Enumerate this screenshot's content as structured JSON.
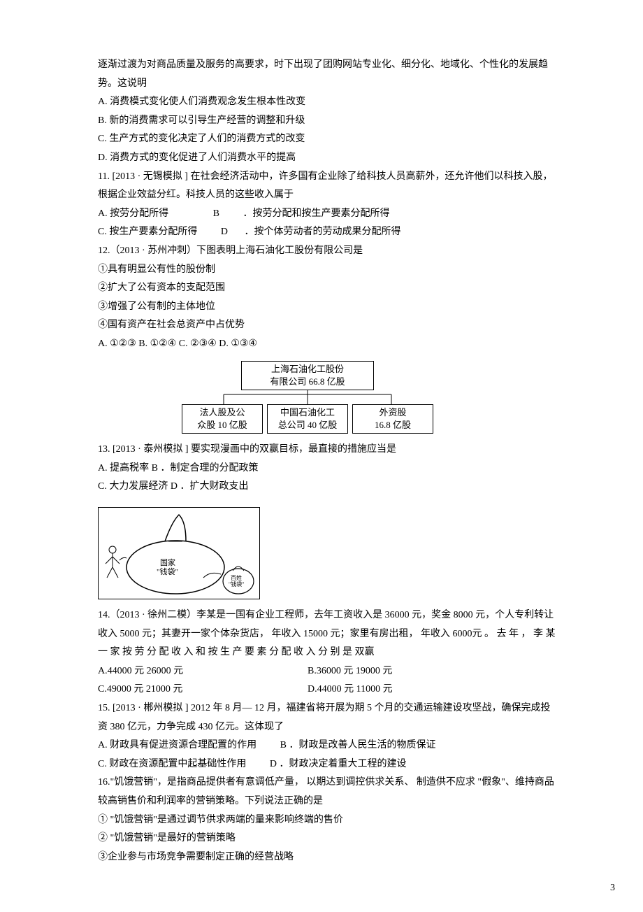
{
  "intro": {
    "l1": "逐渐过渡为对商品质量及服务的高要求，时下出现了团购网站专业化、细分化、地域化、个性化的发展趋势。这说明",
    "a": "A.   消费模式变化使人们消费观念发生根本性改变",
    "b": "B.   新的消费需求可以引导生产经营的调整和升级",
    "c": "C.   生产方式的变化决定了人们的消费方式的改变",
    "d": "D.   消费方式的变化促进了人们消费水平的提高"
  },
  "q11": {
    "stem": "11. [2013 · 无锡模拟  ]   在社会经济活动中，许多国有企业除了给科技人员高薪外，还允许他们以科技入股，根据企业效益分红。科技人员的这些收入属于",
    "a": "A.  按劳分配所得",
    "b": "B",
    "bText": "．按劳分配和按生产要素分配所得",
    "c": "C.  按生产要素分配所得",
    "d": "D",
    "dText": "．按个体劳动者的劳动成果分配所得"
  },
  "q12": {
    "stem": "12.（2013 · 苏州冲刺）下图表明上海石油化工股份有限公司是",
    "o1": "①具有明显公有性的股份制",
    "o2": "②扩大了公有资本的支配范围",
    "o3": "③增强了公有制的主体地位",
    "o4": "④国有资产在社会总资产中占优势",
    "opts": "A. ①②③         B.         ①②④    C.   ②③④         D.         ①③④",
    "diag": {
      "top": "上海石油化工股份\n有限公司 66.8 亿股",
      "c1": "法人股及公\n众股 10 亿股",
      "c2": "中国石油化工\n总公司 40 亿股",
      "c3": "外资股\n16.8 亿股"
    }
  },
  "q13": {
    "stem": "13.   [2013 · 泰州模拟  ]   要实现漫画中的双赢目标，最直接的措施应当是",
    "a": "A.  提高税率    B ．制定合理的分配政策",
    "c": "C.  大力发展经济    D  ．扩大财政支出",
    "bagLabel": "国家\n\"钱袋\"",
    "smallBag": "百姓\n\"钱袋\""
  },
  "q14": {
    "stem": "14.（2013 · 徐州二模）李某是一国有企业工程师，去年工资收入是       36000 元，奖金  8000 元，个人专利转让收入   5000 元；其妻开一家个体杂货店，  年收入 15000 元；家里有房出租，  年收入 6000元 。 去 年 ， 李 某 一 家 按 劳 分 配 收 入 和 按 生 产 要 素 分 配 收 入 分 别 是 双赢",
    "a": "A.44000 元    26000     元",
    "b": "B.36000 元    19000     元",
    "c": "C.49000 元    21000     元",
    "d": "D.44000 元    11000     元"
  },
  "q15": {
    "stem": "15.   [2013 · 郴州模拟  ] 2012   年 8 月— 12 月，福建省将开展为期    5 个月的交通运输建设攻坚战，确保完成投资   380 亿元，力争完成   430 亿元。这体现了",
    "a": "A.  财政具有促进资源合理配置的作用",
    "b": "B  ．财政是改善人民生活的物质保证",
    "c": "C.  财政在资源配置中起基础性作用",
    "d": "D    ．财政决定着重大工程的建设"
  },
  "q16": {
    "stem": "16.\"饥饿营销\"，是指商品提供者有意调低产量，   以期达到调控供求关系、  制造供不应求 \"假象\"、维持商品较高销售价和利润率的营销策略。下列说法正确的是",
    "o1": "① \"饥饿营销\"是通过调节供求两端的量来影响终端的售价",
    "o2": "② \"饥饿营销\"是最好的营销策略",
    "o3": "③企业参与市场竞争需要制定正确的经营战略"
  },
  "pageNumber": "3"
}
